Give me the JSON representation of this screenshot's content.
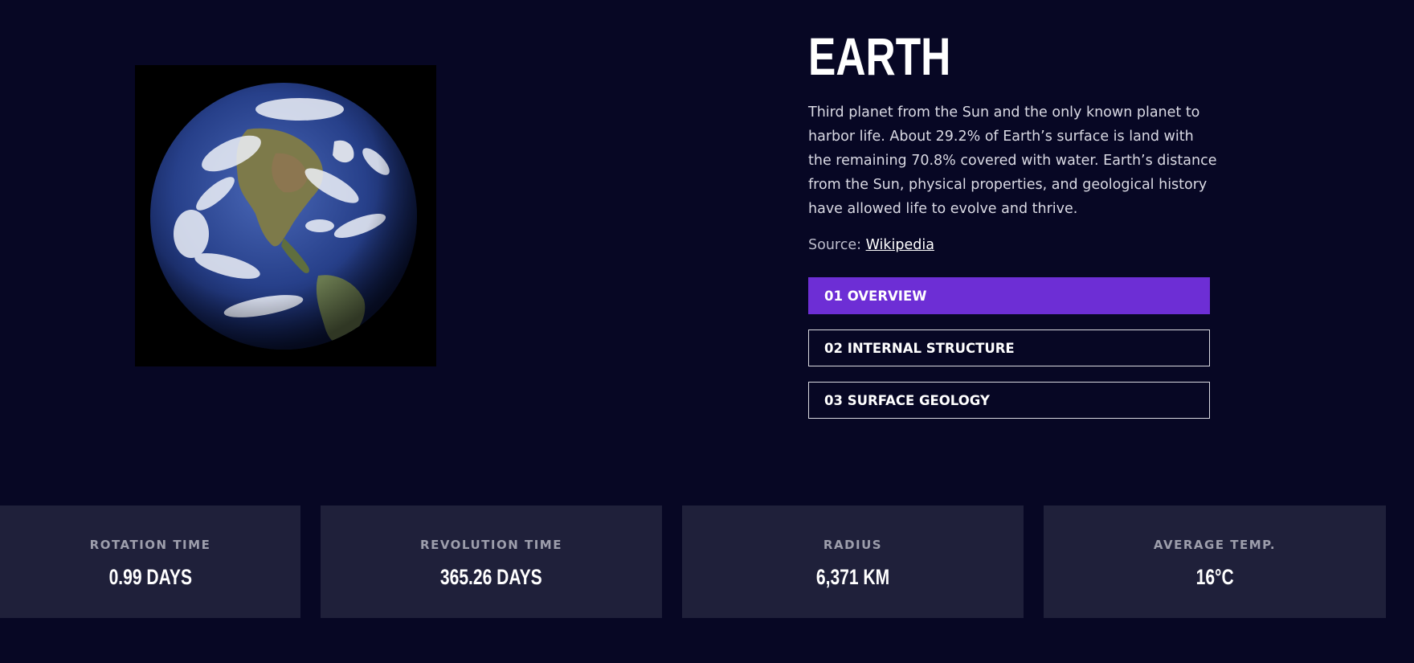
{
  "planet": {
    "name": "EARTH",
    "description": "Third planet from the Sun and the only known planet to harbor life. About 29.2% of Earth’s surface is land with the remaining 70.8% covered with water. Earth’s distance from the Sun, physical properties, and geological history have allowed life to evolve and thrive.",
    "source_label": "Source:",
    "source_link": "Wikipedia"
  },
  "tabs": [
    {
      "label": "01 OVERVIEW",
      "active": true
    },
    {
      "label": "02 INTERNAL STRUCTURE",
      "active": false
    },
    {
      "label": "03 SURFACE GEOLOGY",
      "active": false
    }
  ],
  "stats": [
    {
      "label": "ROTATION TIME",
      "value": "0.99 DAYS"
    },
    {
      "label": "REVOLUTION TIME",
      "value": "365.26 DAYS"
    },
    {
      "label": "RADIUS",
      "value": "6,371 KM"
    },
    {
      "label": "AVERAGE TEMP.",
      "value": "16°C"
    }
  ],
  "colors": {
    "background": "#070724",
    "accent": "#6d2ed5",
    "stat_card": "#1f203a"
  },
  "icons": {
    "planet_image": "earth-globe-image"
  }
}
